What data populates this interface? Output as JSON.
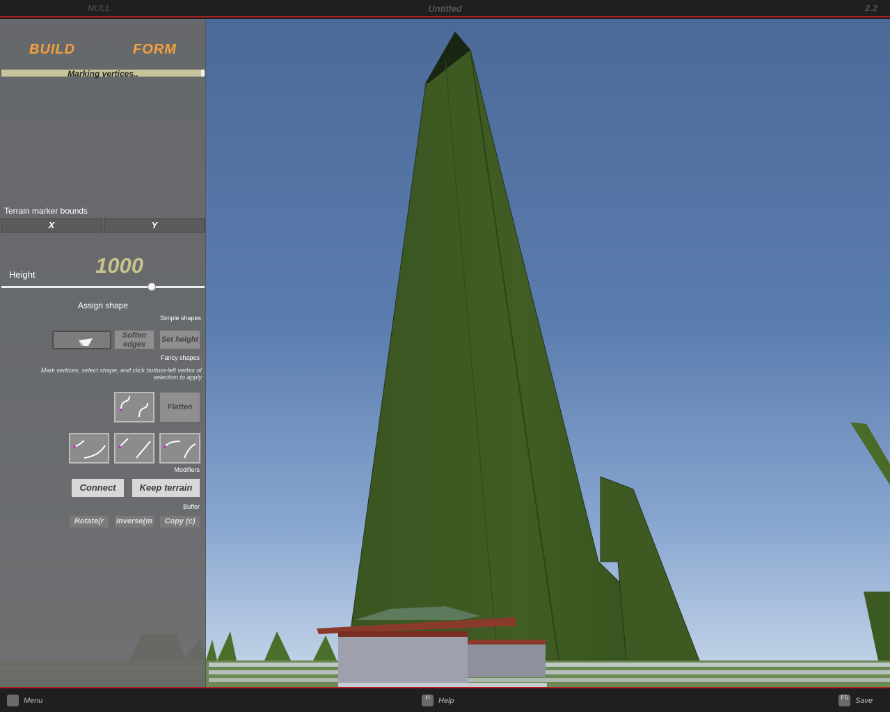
{
  "topbar": {
    "left_text": "NULL",
    "title": "Untitled",
    "version": "2.2"
  },
  "panel": {
    "tabs": [
      {
        "label": "BUILD"
      },
      {
        "label": "FORM"
      }
    ],
    "progress": {
      "label": "Marking vertices..",
      "value": 0.98
    },
    "terrain_marker_bounds": {
      "label": "Terrain marker bounds",
      "x_label": "X",
      "y_label": "Y"
    },
    "height": {
      "label": "Height",
      "value": "1000",
      "slider_fraction": 0.74
    },
    "assign_shape": "Assign shape",
    "simple_shapes_label": "Simple shapes",
    "simple_shapes": {
      "soften_edges": "Soften edges",
      "set_height": "Set height"
    },
    "fancy_shapes_label": "Fancy shapes",
    "hint": "Mark vertices, select shape, and click bottom-left vertex of selection to apply",
    "flatten_label": "Flatten",
    "modifiers_label": "Modifiers",
    "modifiers": {
      "connect": "Connect",
      "keep_terrain": "Keep terrain"
    },
    "buffer_label": "Buffer",
    "buffer": {
      "rotate": "Rotate(r",
      "inverse": "Inverse(m",
      "copy": "Copy (c)"
    }
  },
  "bottombar": {
    "menu": {
      "key": "",
      "label": "Menu"
    },
    "help": {
      "key": "H",
      "label": "Help"
    },
    "save": {
      "key": "F5",
      "label": "Save"
    }
  },
  "colors": {
    "accent": "#f5a03a",
    "panel": "#686868",
    "terrain": "#3d5a22",
    "sky": "#5a7cae",
    "border_red": "#b02020"
  }
}
